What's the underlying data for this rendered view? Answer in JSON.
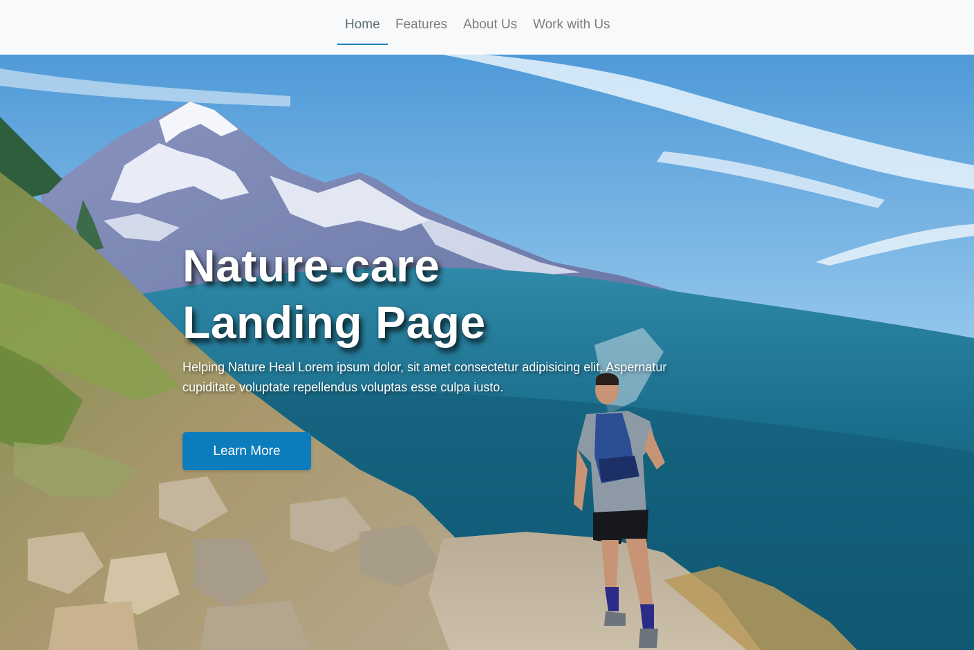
{
  "nav": {
    "items": [
      {
        "label": "Home",
        "active": true
      },
      {
        "label": "Features",
        "active": false
      },
      {
        "label": "About Us",
        "active": false
      },
      {
        "label": "Work with Us",
        "active": false
      }
    ]
  },
  "hero": {
    "title_line1": "Nature-care",
    "title_line2": "Landing Page",
    "subtitle": "Helping Nature Heal Lorem ipsum dolor, sit amet consectetur adipisicing elit. Aspernatur cupiditate voluptate repellendus voluptas esse culpa iusto.",
    "cta_label": "Learn More",
    "image": "mountain-trail-runner-photo"
  },
  "colors": {
    "accent": "#0c7cbc",
    "nav_background": "#f8f9fa",
    "nav_text": "#7d7d7d",
    "active_underline": "#1c7fb8"
  }
}
